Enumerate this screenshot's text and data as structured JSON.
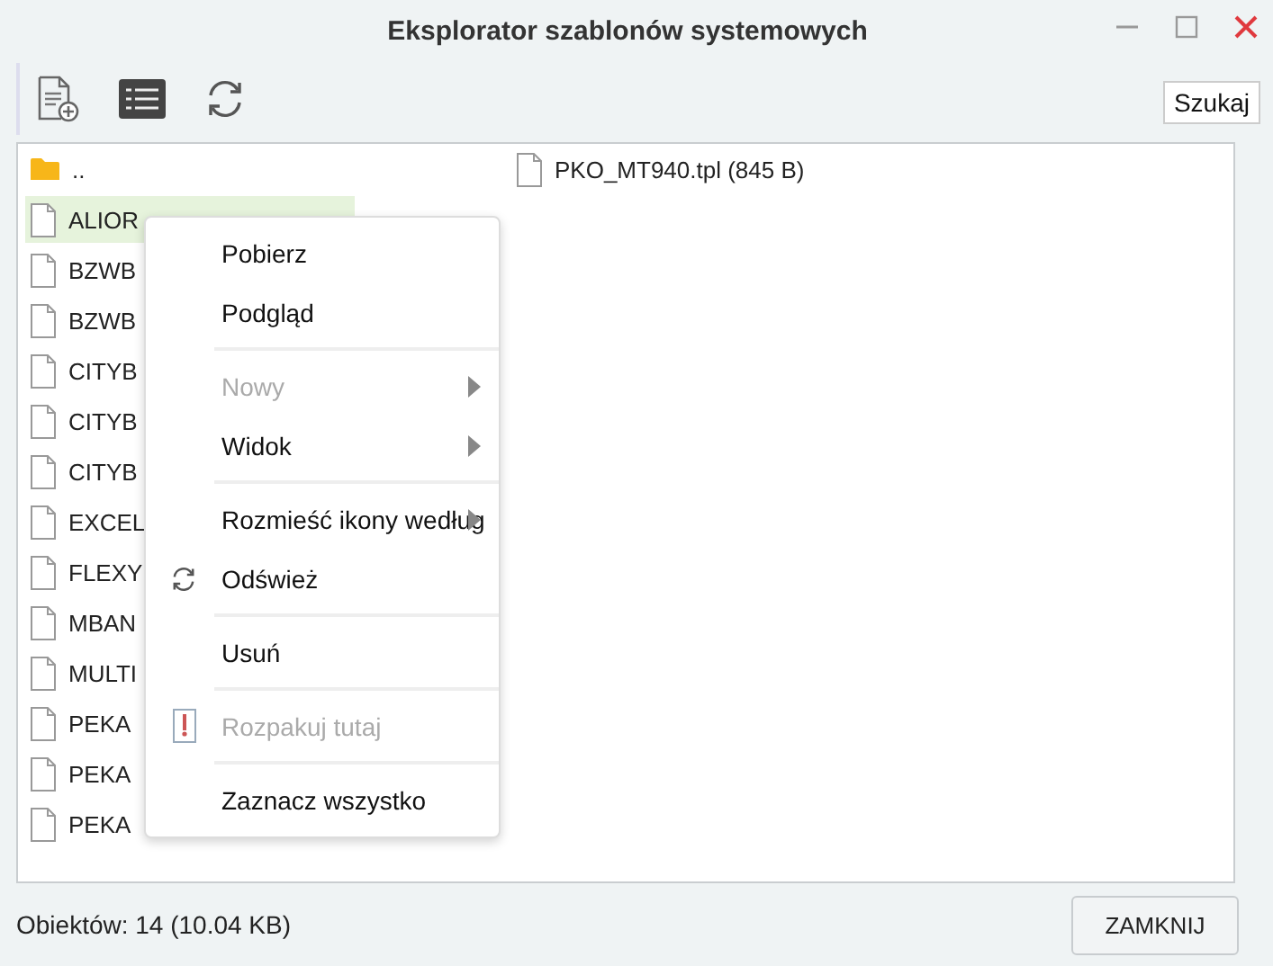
{
  "window": {
    "title": "Eksplorator szablonów systemowych"
  },
  "toolbar": {
    "search_button": "Szukaj"
  },
  "files": [
    {
      "name": "..",
      "kind": "folder",
      "selected": false
    },
    {
      "name": "ALIOR",
      "kind": "file",
      "selected": true
    },
    {
      "name": "BZWB",
      "kind": "file",
      "selected": false
    },
    {
      "name": "BZWB",
      "kind": "file",
      "selected": false
    },
    {
      "name": "CITYB",
      "kind": "file",
      "selected": false
    },
    {
      "name": "CITYB",
      "kind": "file",
      "selected": false
    },
    {
      "name": "CITYB",
      "kind": "file",
      "selected": false
    },
    {
      "name": "EXCEL",
      "kind": "file",
      "selected": false
    },
    {
      "name": "FLEXY",
      "kind": "file",
      "selected": false
    },
    {
      "name": "MBAN",
      "kind": "file",
      "selected": false
    },
    {
      "name": "MULTI",
      "kind": "file",
      "selected": false
    },
    {
      "name": "PEKA",
      "kind": "file",
      "selected": false
    },
    {
      "name": "PEKA",
      "kind": "file",
      "selected": false
    },
    {
      "name": "PEKA",
      "kind": "file",
      "selected": false
    },
    {
      "name": "PKO_MT940.tpl (845 B)",
      "kind": "file",
      "selected": false
    }
  ],
  "context_menu": [
    {
      "kind": "item",
      "label": "Pobierz",
      "disabled": false,
      "submenu": false
    },
    {
      "kind": "item",
      "label": "Podgląd",
      "disabled": false,
      "submenu": false
    },
    {
      "kind": "separator"
    },
    {
      "kind": "item",
      "label": "Nowy",
      "disabled": true,
      "submenu": true
    },
    {
      "kind": "item",
      "label": "Widok",
      "disabled": false,
      "submenu": true
    },
    {
      "kind": "separator"
    },
    {
      "kind": "item",
      "label": "Rozmieść ikony według",
      "disabled": false,
      "submenu": true
    },
    {
      "kind": "refresh",
      "label": "Odśwież",
      "disabled": false,
      "submenu": false
    },
    {
      "kind": "separator"
    },
    {
      "kind": "item",
      "label": "Usuń",
      "disabled": false,
      "submenu": false
    },
    {
      "kind": "separator"
    },
    {
      "kind": "extract",
      "label": "Rozpakuj tutaj",
      "disabled": true,
      "submenu": false
    },
    {
      "kind": "separator"
    },
    {
      "kind": "item",
      "label": "Zaznacz wszystko",
      "disabled": false,
      "submenu": false
    }
  ],
  "status_bar": "Obiektów: 14 (10.04 KB)",
  "buttons": [
    "ZAMKNIJ"
  ]
}
